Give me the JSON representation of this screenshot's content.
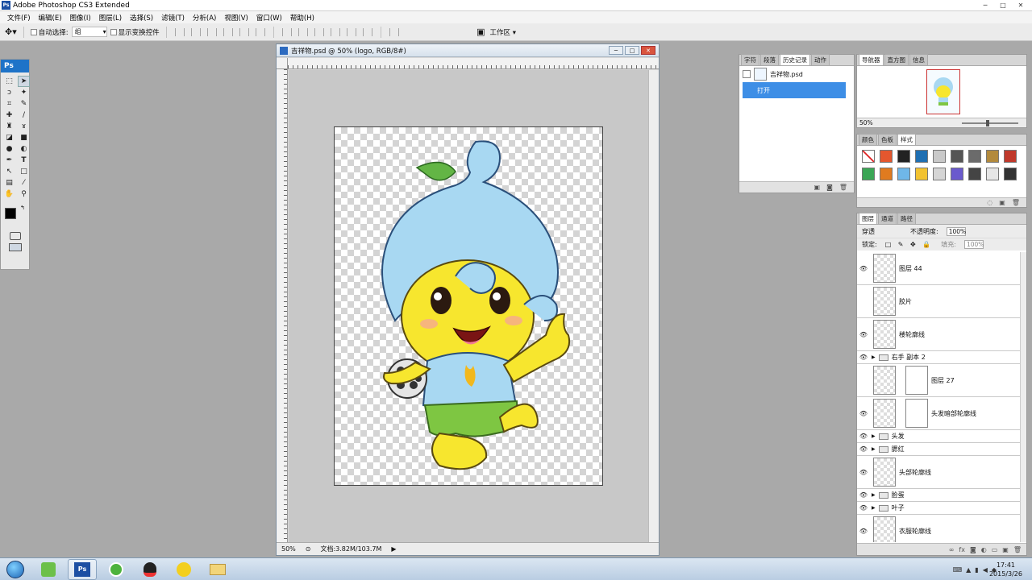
{
  "titlebar": {
    "app_title": "Adobe Photoshop CS3 Extended",
    "app_icon_text": "Ps",
    "minimize": "─",
    "maximize": "□",
    "close": "✕"
  },
  "menubar": {
    "items": [
      "文件(F)",
      "编辑(E)",
      "图像(I)",
      "图层(L)",
      "选择(S)",
      "滤镜(T)",
      "分析(A)",
      "视图(V)",
      "窗口(W)",
      "帮助(H)"
    ]
  },
  "options": {
    "auto_select_label": "自动选择:",
    "auto_select_value": "组",
    "show_transform_label": "显示变换控件",
    "workspace_label": "工作区 ▾"
  },
  "tools": {
    "header": "Ps",
    "icons": [
      "move-icon",
      "marquee-icon",
      "lasso-icon",
      "magic-wand-icon",
      "crop-icon",
      "slice-icon",
      "healing-icon",
      "brush-icon",
      "stamp-icon",
      "history-brush-icon",
      "eraser-icon",
      "gradient-icon",
      "blur-icon",
      "dodge-icon",
      "pen-icon",
      "type-icon",
      "path-select-icon",
      "shape-icon",
      "notes-icon",
      "eyedropper-icon",
      "hand-icon",
      "zoom-icon"
    ]
  },
  "document": {
    "title": "吉祥物.psd @ 50% (logo, RGB/8#)",
    "zoom": "50%",
    "doc_info": "文档:3.82M/103.7M"
  },
  "history": {
    "tabs": [
      "字符",
      "段落",
      "历史记录",
      "动作"
    ],
    "active_tab": "历史记录",
    "snapshot_label": "吉祥物.psd",
    "state_label": "打开"
  },
  "navigator": {
    "tabs": [
      "导航器",
      "直方图",
      "信息"
    ],
    "active_tab": "导航器",
    "zoom": "50%"
  },
  "styles": {
    "tabs": [
      "颜色",
      "色板",
      "样式"
    ],
    "active_tab": "样式",
    "swatch_colors": [
      "#ffffff",
      "#e4572e",
      "#222222",
      "#1f6fb2",
      "#c9c9c9",
      "#555555",
      "#6b6b6b",
      "#b38a3c",
      "#c0392b",
      "#3aa655",
      "#e07b1f",
      "#6fb7e8",
      "#f2c230",
      "#d5d5d5",
      "#6a5acd",
      "#444444",
      "#e6e6e6",
      "#333333"
    ]
  },
  "layers": {
    "tabs": [
      "图层",
      "通道",
      "路径"
    ],
    "active_tab": "图层",
    "blend_mode": "穿透",
    "opacity_label": "不透明度:",
    "opacity_value": "100%",
    "lock_label": "锁定:",
    "fill_label": "填充:",
    "fill_value": "100%",
    "rows": [
      {
        "name": "图层 44",
        "visible": true,
        "type": "layer",
        "mask": false
      },
      {
        "name": "胶片",
        "visible": false,
        "type": "layer",
        "mask": false
      },
      {
        "name": "楼轮廓线",
        "visible": true,
        "type": "layer",
        "mask": false
      },
      {
        "name": "右手 副本 2",
        "visible": true,
        "type": "group",
        "mask": false
      },
      {
        "name": "图层 27",
        "visible": false,
        "type": "layer",
        "mask": true
      },
      {
        "name": "头发暗部轮廓线",
        "visible": true,
        "type": "layer",
        "mask": true
      },
      {
        "name": "头发",
        "visible": true,
        "type": "group",
        "mask": false
      },
      {
        "name": "腮红",
        "visible": true,
        "type": "group",
        "mask": false
      },
      {
        "name": "头部轮廓线",
        "visible": true,
        "type": "layer",
        "mask": false
      },
      {
        "name": "脸蛋",
        "visible": true,
        "type": "group",
        "mask": false
      },
      {
        "name": "叶子",
        "visible": true,
        "type": "group",
        "mask": false
      },
      {
        "name": "衣服轮廓线",
        "visible": true,
        "type": "layer",
        "mask": false
      }
    ]
  },
  "taskbar": {
    "apps": [
      "photoshop-app",
      "360-browser-app",
      "qq-app",
      "qq-music-app",
      "explorer-app"
    ],
    "time": "17:41",
    "date": "2015/3/26"
  }
}
